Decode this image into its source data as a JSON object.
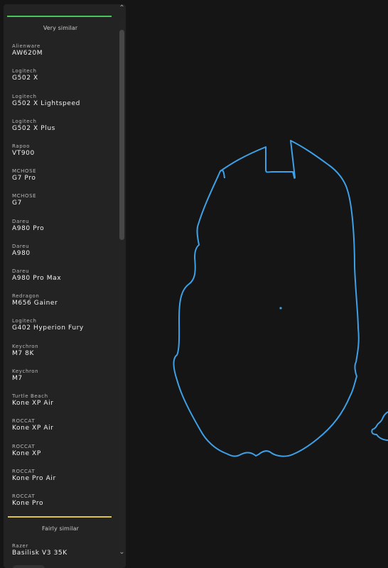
{
  "sidebar": {
    "sections": [
      {
        "title": "Very similar",
        "accent": "#49c75a",
        "items": [
          {
            "brand": "Alienware",
            "model": "AW620M"
          },
          {
            "brand": "Logitech",
            "model": "G502 X"
          },
          {
            "brand": "Logitech",
            "model": "G502 X Lightspeed"
          },
          {
            "brand": "Logitech",
            "model": "G502 X Plus"
          },
          {
            "brand": "Rapoo",
            "model": "VT900"
          },
          {
            "brand": "MCHOSE",
            "model": "G7 Pro"
          },
          {
            "brand": "MCHOSE",
            "model": "G7"
          },
          {
            "brand": "Dareu",
            "model": "A980 Pro"
          },
          {
            "brand": "Dareu",
            "model": "A980"
          },
          {
            "brand": "Dareu",
            "model": "A980 Pro Max"
          },
          {
            "brand": "Redragon",
            "model": "M656 Gainer"
          },
          {
            "brand": "Logitech",
            "model": "G402 Hyperion Fury"
          },
          {
            "brand": "Keychron",
            "model": "M7 8K"
          },
          {
            "brand": "Keychron",
            "model": "M7"
          },
          {
            "brand": "Turtle Beach",
            "model": "Kone XP Air"
          },
          {
            "brand": "ROCCAT",
            "model": "Kone XP Air"
          },
          {
            "brand": "ROCCAT",
            "model": "Kone XP"
          },
          {
            "brand": "ROCCAT",
            "model": "Kone Pro Air"
          },
          {
            "brand": "ROCCAT",
            "model": "Kone Pro"
          }
        ]
      },
      {
        "title": "Fairly similar",
        "accent": "#dfc33f",
        "items": [
          {
            "brand": "Razer",
            "model": "Basilisk V3 35K"
          }
        ]
      }
    ],
    "scroll_up_icon": "chevron-up-icon",
    "scroll_down_icon": "chevron-down-icon"
  },
  "canvas": {
    "outline_color": "#3ea0e6",
    "background": "#151515",
    "center_marker": "center-dot-icon"
  }
}
